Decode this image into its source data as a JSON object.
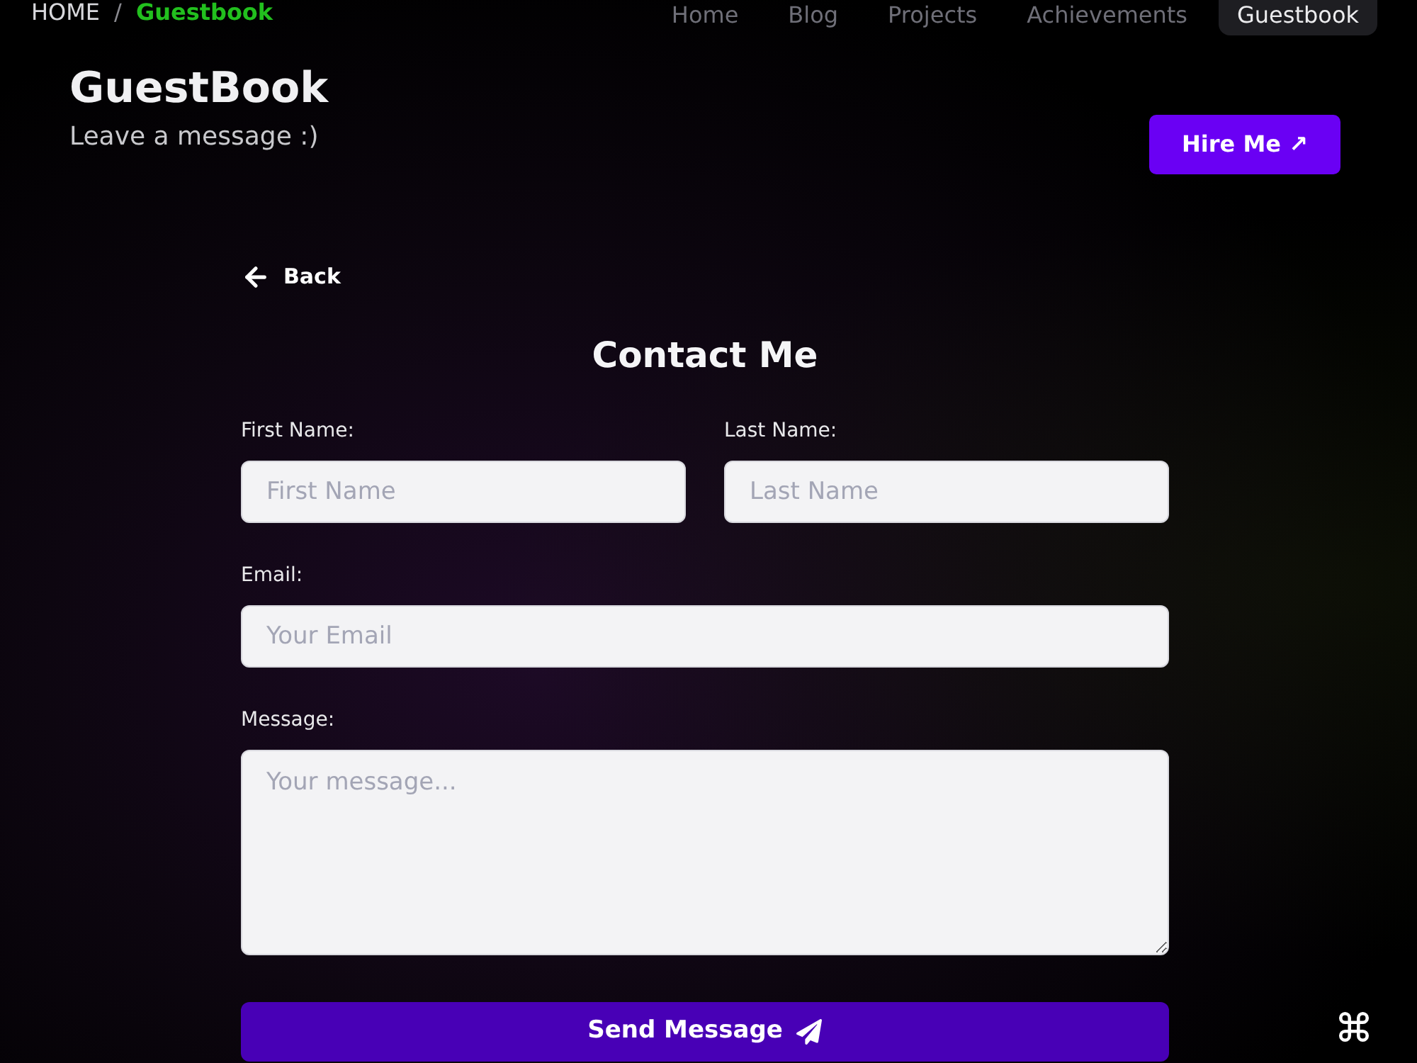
{
  "breadcrumb": {
    "items": [
      {
        "label": "HOME",
        "selected": false
      },
      {
        "label": "Guestbook",
        "selected": true
      }
    ],
    "separator": "/"
  },
  "nav": [
    {
      "label": "Home",
      "selected": false
    },
    {
      "label": "Blog",
      "selected": false
    },
    {
      "label": "Projects",
      "selected": false
    },
    {
      "label": "Achievements",
      "selected": false
    },
    {
      "label": "Guestbook",
      "selected": true
    }
  ],
  "header": {
    "title": "GuestBook",
    "subtitle": "Leave a message :)",
    "hire_button": "Hire Me ↗"
  },
  "form": {
    "back": "Back",
    "title": "Contact Me",
    "rows": [
      [
        {
          "label": "First Name:",
          "placeholder": "First Name",
          "kind": "input"
        },
        {
          "label": "Last Name:",
          "placeholder": "Last Name",
          "kind": "input"
        }
      ],
      [
        {
          "label": "Email:",
          "placeholder": "Your Email",
          "kind": "input"
        }
      ],
      [
        {
          "label": "Message:",
          "placeholder": "Your message...",
          "kind": "textarea"
        }
      ]
    ],
    "submit": "Send Message"
  }
}
